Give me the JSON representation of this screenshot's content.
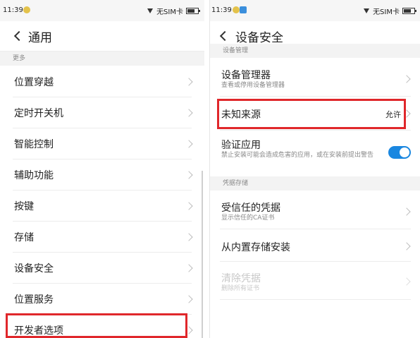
{
  "left": {
    "status": {
      "time": "11:39",
      "carrier": "无SIM卡"
    },
    "title": "通用",
    "section": "更多",
    "items": [
      {
        "label": "位置穿越"
      },
      {
        "label": "定时开关机"
      },
      {
        "label": "智能控制"
      },
      {
        "label": "辅助功能"
      },
      {
        "label": "按键"
      },
      {
        "label": "存储"
      },
      {
        "label": "设备安全"
      },
      {
        "label": "位置服务"
      },
      {
        "label": "开发者选项"
      }
    ]
  },
  "right": {
    "status": {
      "time": "11:39",
      "carrier": "无SIM卡"
    },
    "title": "设备安全",
    "sections": {
      "device_management": "设备管理",
      "credential_storage": "凭据存储"
    },
    "device_admin": {
      "label": "设备管理器",
      "sub": "查看或停用设备管理器"
    },
    "unknown_sources": {
      "label": "未知来源",
      "value": "允许"
    },
    "verify_apps": {
      "label": "验证应用",
      "sub": "禁止安装可能会造成危害的应用，或在安装前提出警告",
      "enabled": true
    },
    "trusted_credentials": {
      "label": "受信任的凭据",
      "sub": "显示信任的CA证书"
    },
    "install_from_storage": {
      "label": "从内置存储安装"
    },
    "clear_credentials": {
      "label": "清除凭据",
      "sub": "删除所有证书",
      "disabled": true
    }
  },
  "colors": {
    "accent": "#1a87e0",
    "highlight": "#e0272b"
  }
}
